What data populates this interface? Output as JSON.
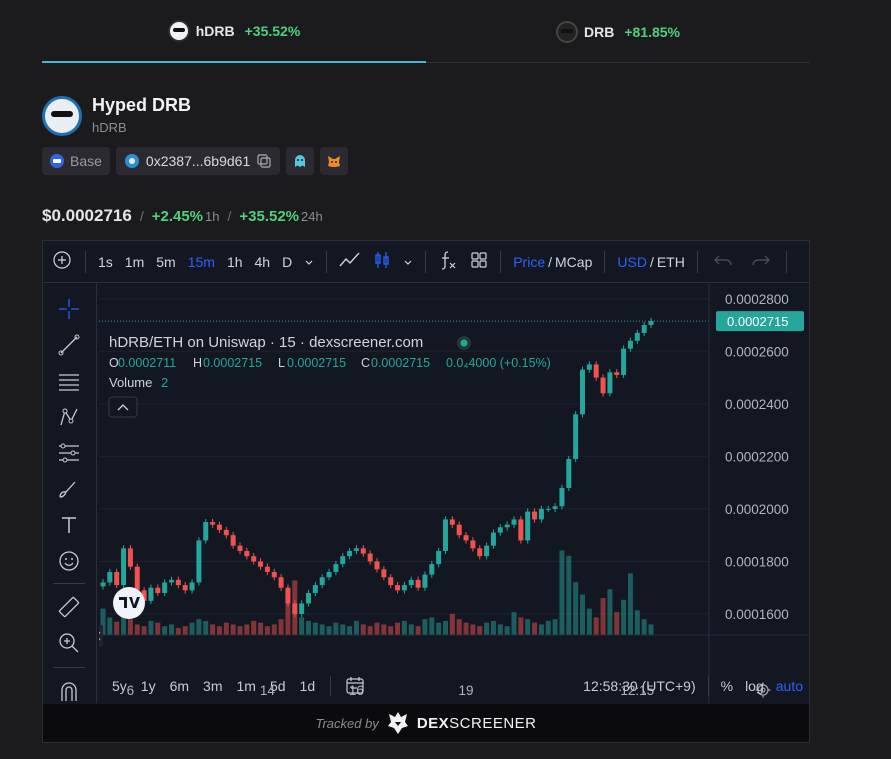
{
  "tabs": [
    {
      "name": "hDRB",
      "change": "+35.52%",
      "active": true
    },
    {
      "name": "DRB",
      "change": "+81.85%",
      "active": false
    }
  ],
  "token": {
    "name": "Hyped DRB",
    "symbol": "hDRB",
    "chain": "Base",
    "address": "0x2387...6b9d61"
  },
  "price": {
    "value": "$0.0002716",
    "change_1h": "+2.45%",
    "label_1h": "1h",
    "change_24h": "+35.52%",
    "label_24h": "24h",
    "separator": "/"
  },
  "toolbar": {
    "intervals": [
      "1s",
      "1m",
      "5m",
      "15m",
      "1h",
      "4h",
      "D"
    ],
    "active_interval": "15m",
    "price_label": "Price",
    "mcap_label": "MCap",
    "usd_label": "USD",
    "eth_label": "ETH",
    "slash": "/"
  },
  "legend": {
    "title": "hDRB/ETH on Uniswap · 15 · dexscreener.com",
    "o_label": "O",
    "o": "0.0002711",
    "h_label": "H",
    "h": "0.0002715",
    "l_label": "L",
    "l": "0.0002715",
    "c_label": "C",
    "c": "0.0002715",
    "chg": "0.0₄4000 (+0.15%)",
    "volume_label": "Volume",
    "volume_value": "2"
  },
  "chart_data": {
    "type": "candlestick",
    "y_ticks": [
      "0.0002800",
      "0.0002600",
      "0.0002400",
      "0.0002200",
      "0.0002000",
      "0.0001800",
      "0.0001600"
    ],
    "y_values": [
      0.00028,
      0.00026,
      0.00024,
      0.00022,
      0.0002,
      0.00018,
      0.00016
    ],
    "ylim": [
      0.000152,
      0.000286
    ],
    "x_ticks": [
      "6",
      "14",
      "16",
      "19",
      "12:15"
    ],
    "last_price_label": "0.0002715",
    "last_price": 0.0002715,
    "closes": [
      0.000172,
      0.000176,
      0.000171,
      0.000185,
      0.000178,
      0.000169,
      0.000165,
      0.00017,
      0.000168,
      0.000172,
      0.000173,
      0.000171,
      0.000169,
      0.000172,
      0.000188,
      0.000195,
      0.000194,
      0.000192,
      0.00019,
      0.000186,
      0.000184,
      0.000182,
      0.00018,
      0.000178,
      0.000176,
      0.000174,
      0.00017,
      0.000164,
      0.00016,
      0.000164,
      0.000168,
      0.000171,
      0.000174,
      0.000176,
      0.000179,
      0.000182,
      0.000184,
      0.000185,
      0.000183,
      0.00018,
      0.000177,
      0.000174,
      0.000171,
      0.000169,
      0.000171,
      0.000173,
      0.00017,
      0.000175,
      0.000179,
      0.000184,
      0.000196,
      0.000194,
      0.00019,
      0.000188,
      0.000185,
      0.000182,
      0.000186,
      0.000191,
      0.000193,
      0.000194,
      0.000196,
      0.000188,
      0.000199,
      0.000196,
      0.0002,
      0.0002,
      0.000201,
      0.000208,
      0.000219,
      0.000236,
      0.000253,
      0.000255,
      0.00025,
      0.000244,
      0.000252,
      0.000251,
      0.000261,
      0.000264,
      0.000267,
      0.00027,
      0.0002715
    ],
    "volumes": [
      0.3,
      0.2,
      0.15,
      0.22,
      0.18,
      0.12,
      0.1,
      0.16,
      0.14,
      0.1,
      0.12,
      0.08,
      0.1,
      0.14,
      0.18,
      0.16,
      0.12,
      0.1,
      0.14,
      0.12,
      0.1,
      0.12,
      0.16,
      0.14,
      0.1,
      0.12,
      0.18,
      0.48,
      0.62,
      0.2,
      0.16,
      0.14,
      0.12,
      0.1,
      0.14,
      0.12,
      0.1,
      0.16,
      0.12,
      0.1,
      0.14,
      0.12,
      0.1,
      0.14,
      0.16,
      0.12,
      0.1,
      0.18,
      0.2,
      0.14,
      0.16,
      0.24,
      0.18,
      0.14,
      0.12,
      0.1,
      0.14,
      0.16,
      0.12,
      0.1,
      0.26,
      0.2,
      0.18,
      0.14,
      0.12,
      0.16,
      0.18,
      0.96,
      0.9,
      0.6,
      0.46,
      0.3,
      0.2,
      0.42,
      0.52,
      0.26,
      0.4,
      0.7,
      0.28,
      0.18,
      0.12
    ]
  },
  "bottom": {
    "ranges": [
      "5y",
      "1y",
      "6m",
      "3m",
      "1m",
      "5d",
      "1d"
    ],
    "time": "12:58:30 (UTC+9)",
    "percent": "%",
    "log": "log",
    "auto": "auto"
  },
  "footer": {
    "tracked_by": "Tracked by",
    "brand_a": "DEX",
    "brand_b": "SCREENER"
  },
  "colors": {
    "up": "#26a69a",
    "down": "#ef5350",
    "accent": "#2962ff",
    "green_text": "#4fd17e"
  }
}
